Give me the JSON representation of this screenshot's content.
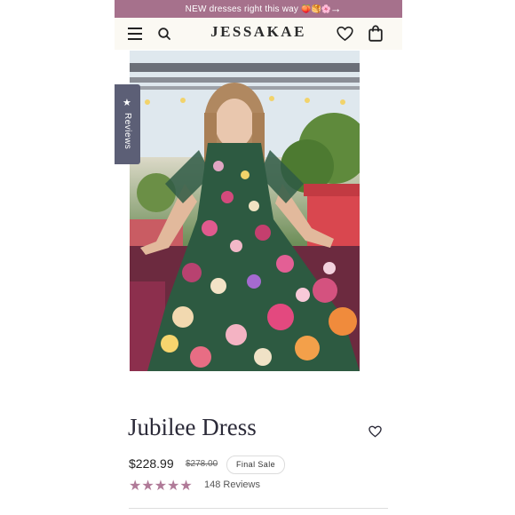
{
  "announcement": {
    "text": "NEW dresses right this way",
    "emojis": "🍑🥞🌸",
    "arrow": "→"
  },
  "header": {
    "logo": "JESSAKAE"
  },
  "reviews_tab": {
    "icon": "★",
    "label": "Reviews"
  },
  "product": {
    "title": "Jubilee Dress",
    "price": "$228.99",
    "compare_price": "$278.00",
    "badge": "Final Sale",
    "rating_stars": 5,
    "review_count": "148 Reviews"
  },
  "colors": {
    "announcement_bg": "#a6718c",
    "header_bg": "#fbf9f3",
    "star": "#b07a98",
    "reviews_tab_bg": "#5c5f76"
  }
}
